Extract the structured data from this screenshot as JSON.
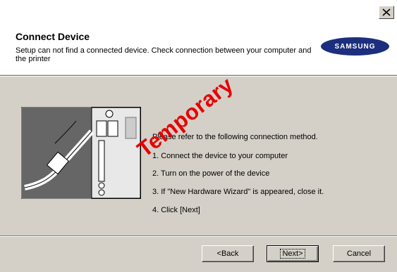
{
  "header": {
    "title": "Connect Device",
    "subtitle": "Setup can not find a connected device. Check connection between your computer and the printer",
    "logo_text": "SAMSUNG"
  },
  "instructions": {
    "intro": "Please refer to the following connection method.",
    "steps": [
      "1. Connect the device to your computer",
      "2. Turn on the power of the device",
      "3. If \"New Hardware Wizard\" is appeared, close it.",
      "4. Click [Next]"
    ]
  },
  "watermark": "Temporary",
  "buttons": {
    "back": "<Back",
    "next": "Next>",
    "cancel": "Cancel"
  },
  "colors": {
    "logo_blue": "#1c2f7e",
    "watermark_red": "#e60000",
    "dialog_gray": "#d4d0c8"
  },
  "icons": {
    "close": "close-icon",
    "illustration": "usb-cable-connection-illustration"
  }
}
